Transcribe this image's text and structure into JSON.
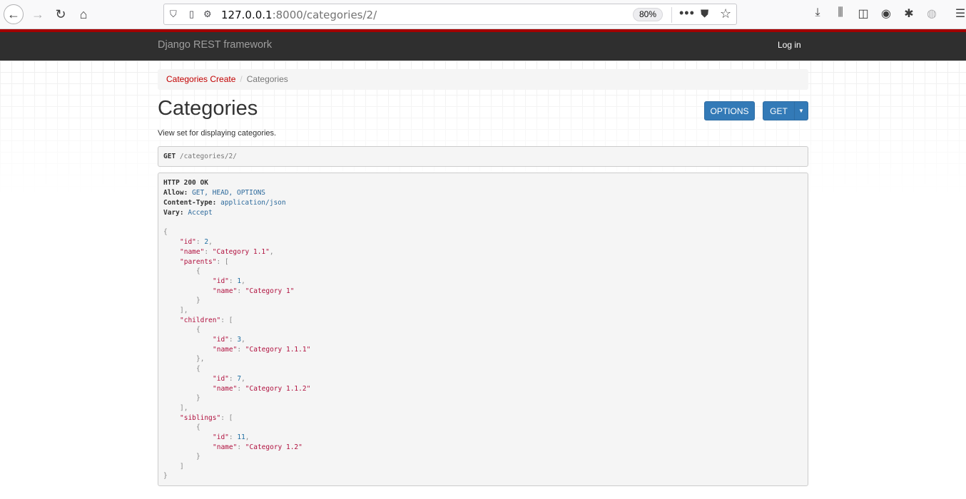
{
  "browser": {
    "url_host": "127.0.0.1",
    "url_rest": ":8000/categories/2/",
    "zoom": "80%"
  },
  "navbar": {
    "brand": "Django REST framework",
    "login": "Log in"
  },
  "breadcrumb": {
    "link": "Categories Create",
    "active": "Categories"
  },
  "page": {
    "title": "Categories",
    "description": "View set for displaying categories.",
    "buttons": {
      "options": "OPTIONS",
      "get": "GET"
    }
  },
  "request": {
    "method": "GET",
    "path": "/categories/2/"
  },
  "response": {
    "status": "HTTP 200 OK",
    "headers": [
      {
        "key": "Allow:",
        "value": "GET, HEAD, OPTIONS"
      },
      {
        "key": "Content-Type:",
        "value": "application/json"
      },
      {
        "key": "Vary:",
        "value": "Accept"
      }
    ],
    "body": {
      "id": "2",
      "name": "\"Category 1.1\"",
      "parents": [
        {
          "id": "1",
          "name": "\"Category 1\""
        }
      ],
      "children": [
        {
          "id": "3",
          "name": "\"Category 1.1.1\""
        },
        {
          "id": "7",
          "name": "\"Category 1.1.2\""
        }
      ],
      "siblings": [
        {
          "id": "11",
          "name": "\"Category 1.2\""
        }
      ]
    }
  },
  "colors": {
    "accent_red": "#a30000",
    "link_red": "#c20000",
    "button_blue": "#337ab7",
    "navbar_bg": "#2f2f2f"
  }
}
